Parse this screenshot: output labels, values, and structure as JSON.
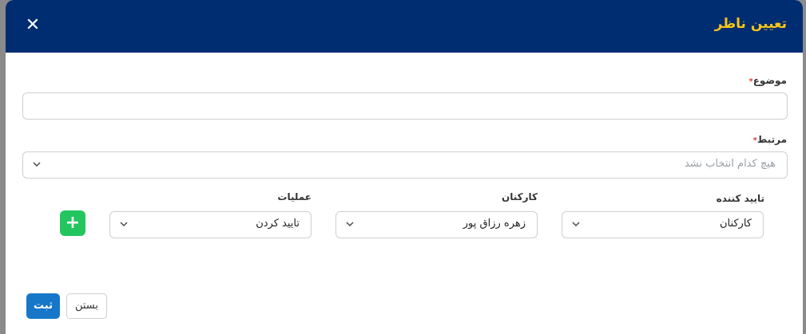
{
  "modal": {
    "title": "تعیین ناظر",
    "close_icon": "close-icon"
  },
  "form": {
    "subject": {
      "label": "موضوع",
      "required_mark": "*",
      "value": ""
    },
    "related": {
      "label": "مرتبط",
      "required_mark": "*",
      "placeholder": "هیچ کدام انتخاب نشد"
    },
    "row": {
      "approver": {
        "label": "تایید کننده",
        "value": "کارکنان"
      },
      "staff": {
        "label": "کارکنان",
        "value": "زهره رزاق پور"
      },
      "operations": {
        "label": "عملیات",
        "value": "تایید کردن"
      },
      "add_label": "+"
    }
  },
  "footer": {
    "submit_label": "ثبت",
    "close_label": "بستن"
  },
  "colors": {
    "header_bg": "#002d72",
    "title": "#f5c518",
    "add_button": "#22c55e",
    "submit_button": "#1677c9"
  }
}
